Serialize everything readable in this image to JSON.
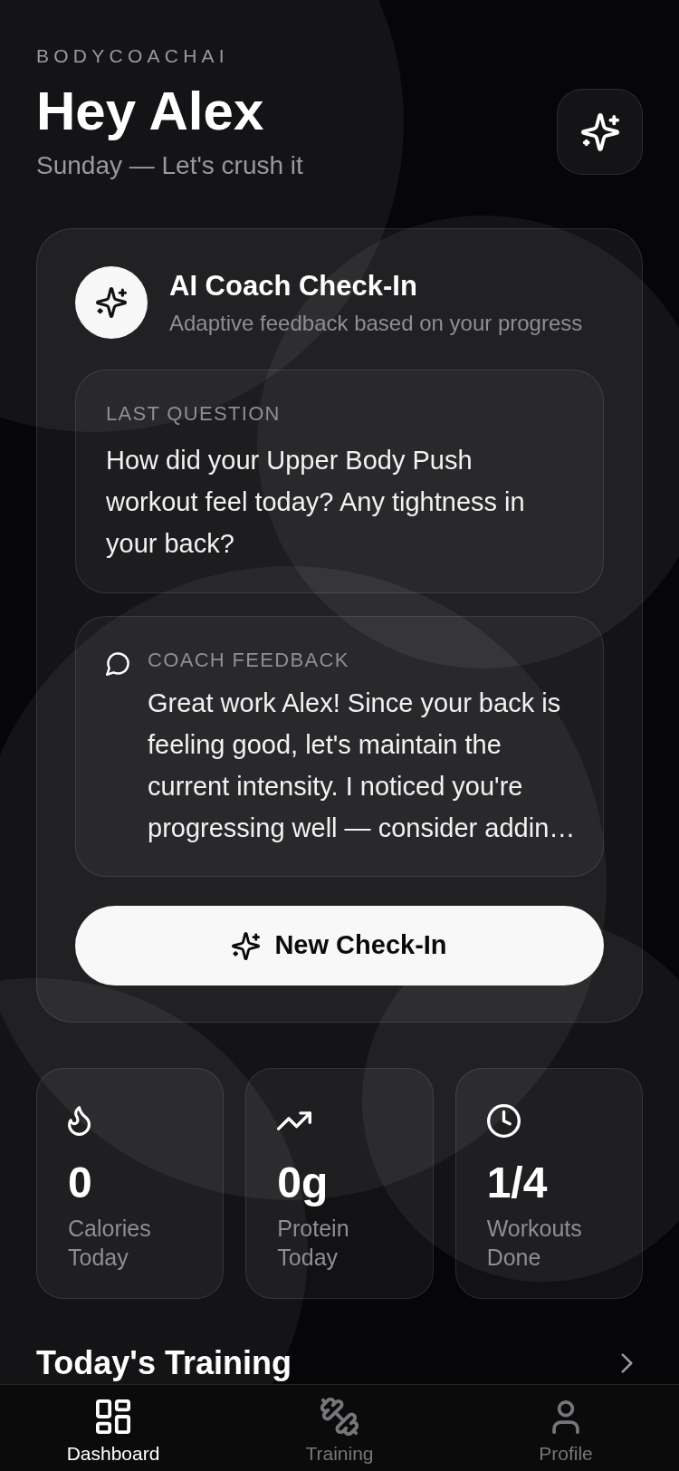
{
  "header": {
    "brand": "BODYCOACHAI",
    "greeting": "Hey Alex",
    "subtitle": "Sunday — Let's crush it"
  },
  "coach_card": {
    "title": "AI Coach Check-In",
    "subtitle": "Adaptive feedback based on your progress",
    "last_question": {
      "label": "LAST QUESTION",
      "text": "How did your Upper Body Push workout feel today? Any tightness in your back?"
    },
    "feedback": {
      "label": "COACH FEEDBACK",
      "text": "Great work Alex! Since your back is feeling good, let's maintain the current intensity. I noticed you're progressing well — consider addin…"
    },
    "button": "New Check-In"
  },
  "stats": [
    {
      "value": "0",
      "label": "Calories Today"
    },
    {
      "value": "0g",
      "label": "Protein Today"
    },
    {
      "value": "1/4",
      "label": "Workouts Done"
    }
  ],
  "section": {
    "title": "Today's Training"
  },
  "bottom_nav": [
    {
      "label": "Dashboard",
      "selected": true
    },
    {
      "label": "Training",
      "selected": false
    },
    {
      "label": "Profile",
      "selected": false
    }
  ]
}
